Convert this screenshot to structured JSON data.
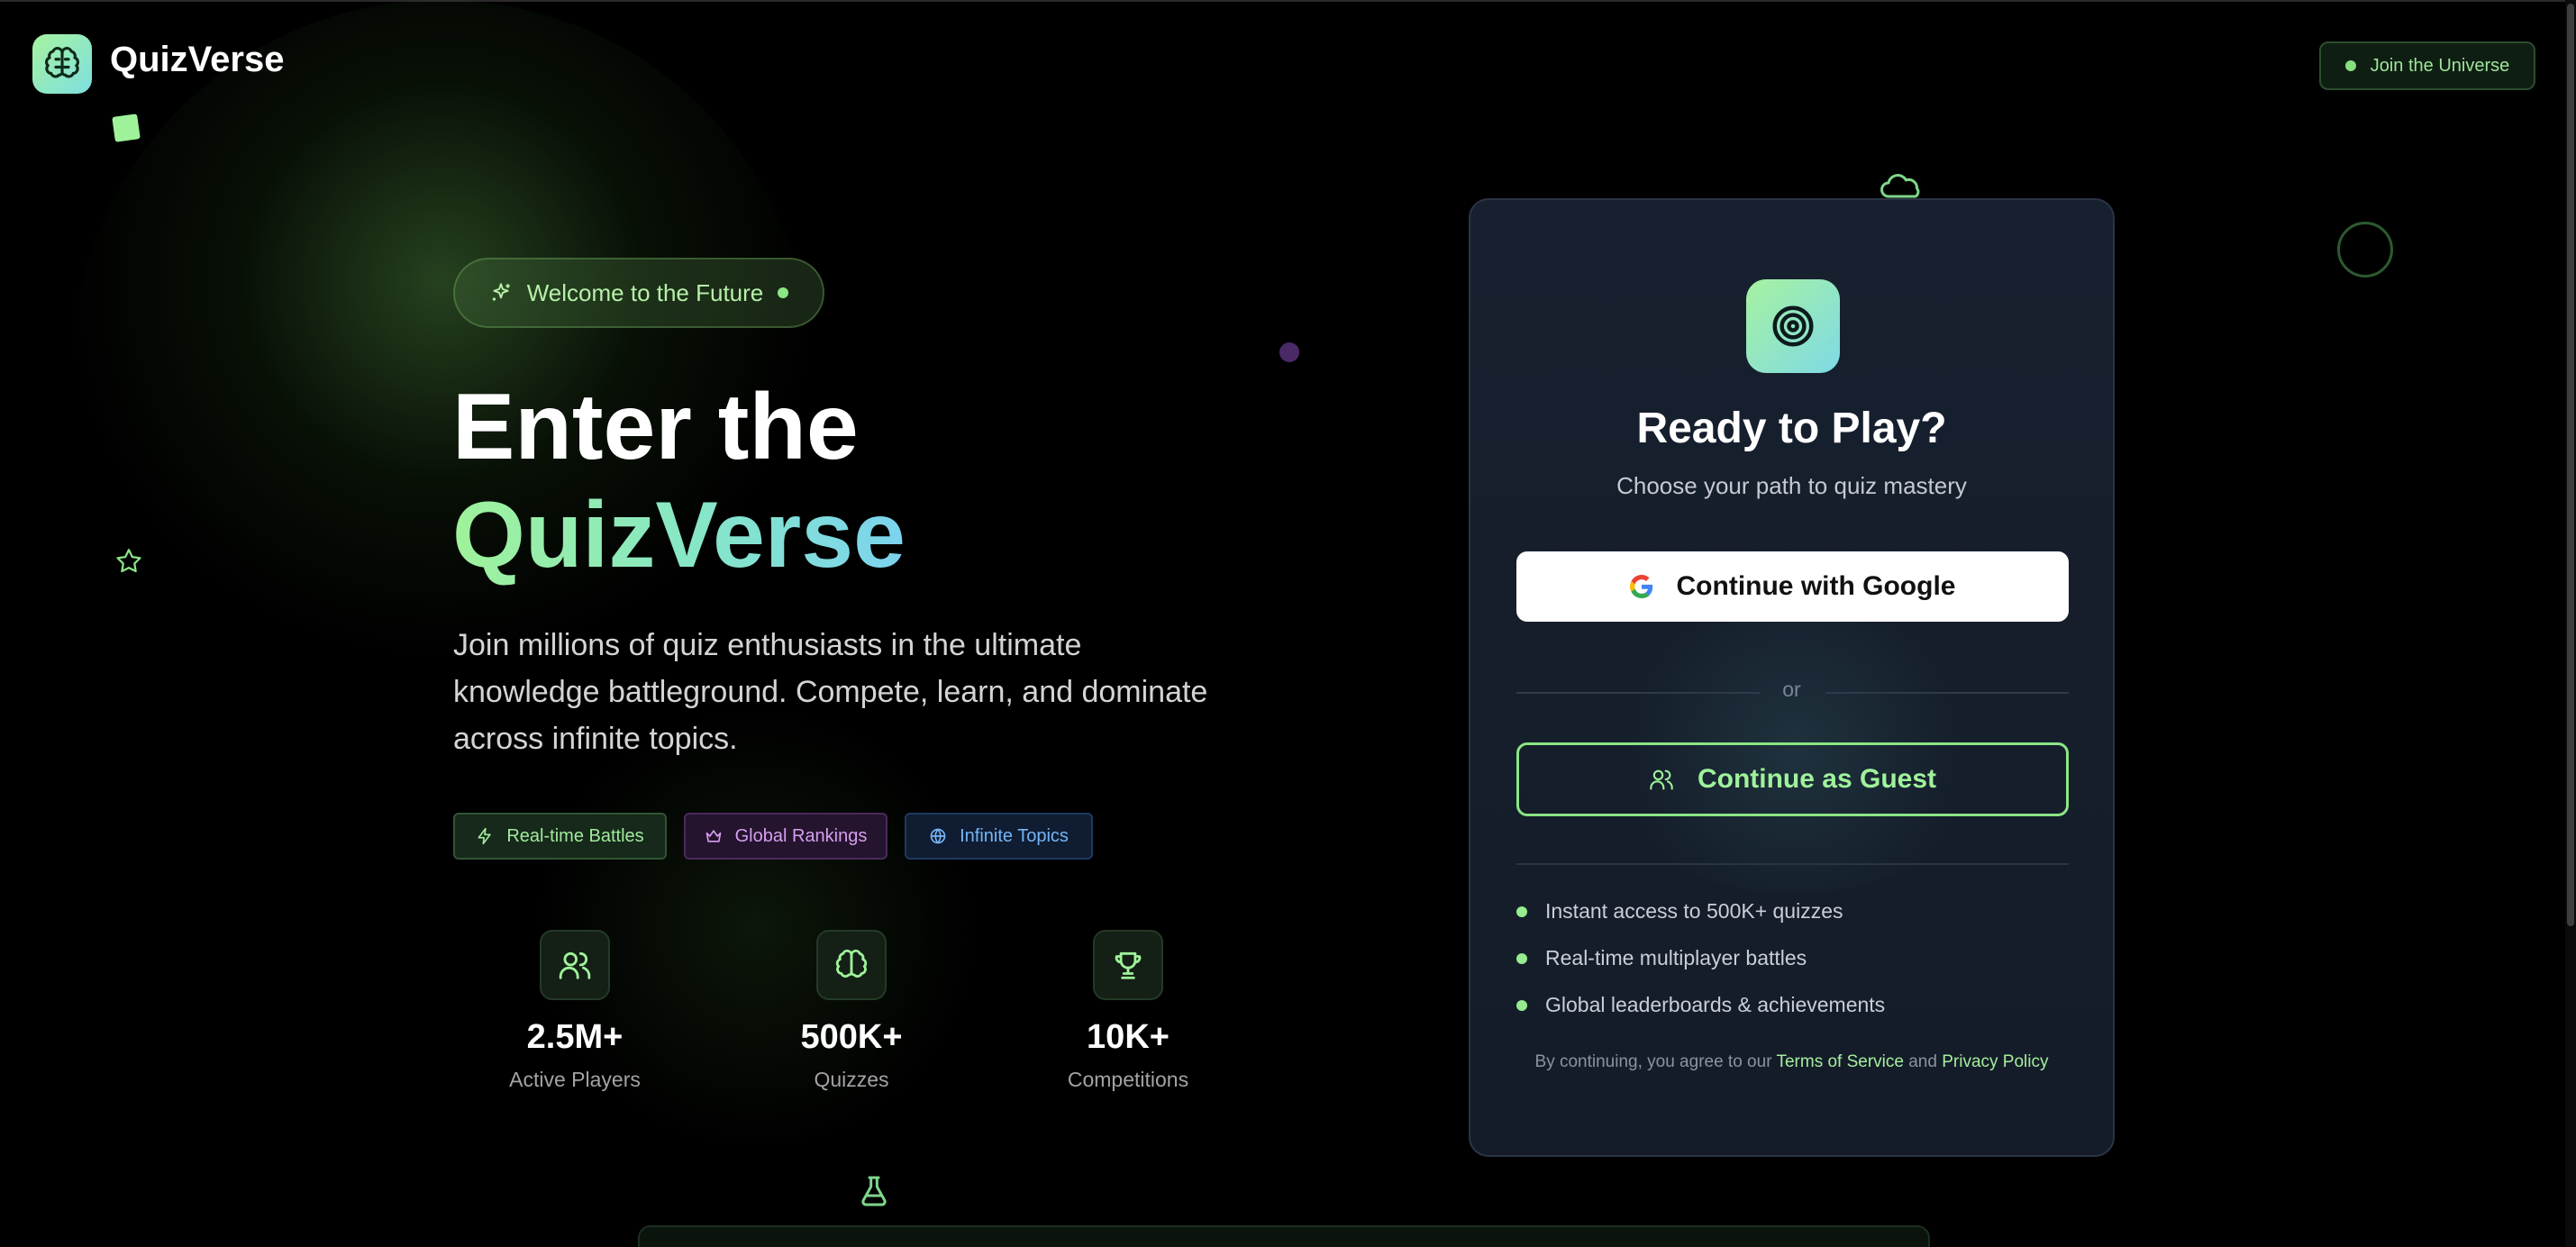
{
  "app": {
    "name": "QuizVerse"
  },
  "header": {
    "join_label": "Join the Universe"
  },
  "hero": {
    "badge": "Welcome to the Future",
    "title_line1": "Enter the",
    "title_line2": "QuizVerse",
    "description": "Join millions of quiz enthusiasts in the ultimate knowledge battleground. Compete, learn, and dominate across infinite topics.",
    "pills": [
      {
        "label": "Real-time Battles",
        "icon": "lightning-icon"
      },
      {
        "label": "Global Rankings",
        "icon": "crown-icon"
      },
      {
        "label": "Infinite Topics",
        "icon": "globe-icon"
      }
    ],
    "stats": [
      {
        "value": "2.5M+",
        "label": "Active Players",
        "icon": "users-icon"
      },
      {
        "value": "500K+",
        "label": "Quizzes",
        "icon": "brain-icon"
      },
      {
        "value": "10K+",
        "label": "Competitions",
        "icon": "trophy-icon"
      }
    ]
  },
  "login": {
    "icon": "target-icon",
    "title": "Ready to Play?",
    "subtitle": "Choose your path to quiz mastery",
    "google_label": "Continue with Google",
    "divider_text": "or",
    "guest_label": "Continue as Guest",
    "features": [
      "Instant access to 500K+ quizzes",
      "Real-time multiplayer battles",
      "Global leaderboards & achievements"
    ],
    "terms": {
      "prefix": "By continuing, you agree to our",
      "terms_link": "Terms of Service",
      "and": "and",
      "privacy_link": "Privacy Policy"
    }
  },
  "colors": {
    "accent_green": "#8be584",
    "accent_cyan": "#7bd3ef",
    "card_bg": "#17202e",
    "pill_purple": "#d69ef0",
    "pill_blue": "#74b5f7"
  }
}
